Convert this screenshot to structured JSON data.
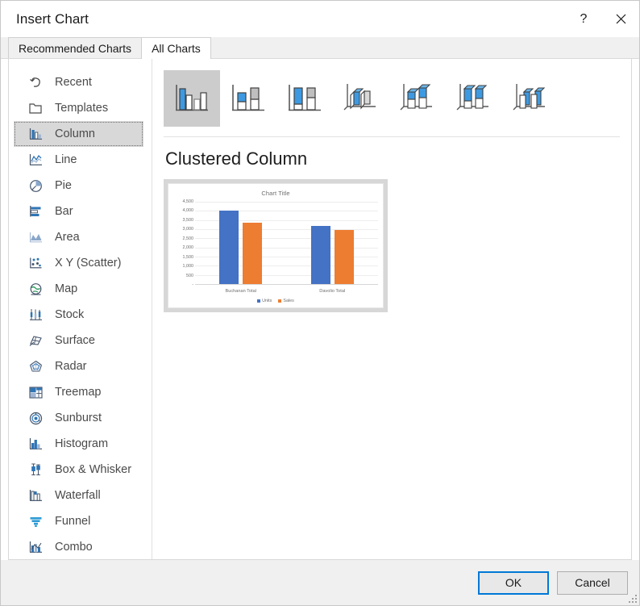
{
  "window": {
    "title": "Insert Chart",
    "help_label": "?",
    "close_label": "Close"
  },
  "tabs": [
    {
      "label": "Recommended Charts",
      "active": false
    },
    {
      "label": "All Charts",
      "active": true
    }
  ],
  "sidebar": {
    "items": [
      {
        "label": "Recent",
        "icon": "recent-icon",
        "selected": false
      },
      {
        "label": "Templates",
        "icon": "templates-icon",
        "selected": false
      },
      {
        "label": "Column",
        "icon": "column-icon",
        "selected": true
      },
      {
        "label": "Line",
        "icon": "line-icon",
        "selected": false
      },
      {
        "label": "Pie",
        "icon": "pie-icon",
        "selected": false
      },
      {
        "label": "Bar",
        "icon": "bar-icon",
        "selected": false
      },
      {
        "label": "Area",
        "icon": "area-icon",
        "selected": false
      },
      {
        "label": "X Y (Scatter)",
        "icon": "scatter-icon",
        "selected": false
      },
      {
        "label": "Map",
        "icon": "map-icon",
        "selected": false
      },
      {
        "label": "Stock",
        "icon": "stock-icon",
        "selected": false
      },
      {
        "label": "Surface",
        "icon": "surface-icon",
        "selected": false
      },
      {
        "label": "Radar",
        "icon": "radar-icon",
        "selected": false
      },
      {
        "label": "Treemap",
        "icon": "treemap-icon",
        "selected": false
      },
      {
        "label": "Sunburst",
        "icon": "sunburst-icon",
        "selected": false
      },
      {
        "label": "Histogram",
        "icon": "histogram-icon",
        "selected": false
      },
      {
        "label": "Box & Whisker",
        "icon": "box-whisker-icon",
        "selected": false
      },
      {
        "label": "Waterfall",
        "icon": "waterfall-icon",
        "selected": false
      },
      {
        "label": "Funnel",
        "icon": "funnel-icon",
        "selected": false
      },
      {
        "label": "Combo",
        "icon": "combo-icon",
        "selected": false
      }
    ]
  },
  "chart_types": [
    {
      "name": "Clustered Column",
      "selected": true
    },
    {
      "name": "Stacked Column",
      "selected": false
    },
    {
      "name": "100% Stacked Column",
      "selected": false
    },
    {
      "name": "3-D Clustered Column",
      "selected": false
    },
    {
      "name": "3-D Stacked Column",
      "selected": false
    },
    {
      "name": "3-D 100% Stacked Column",
      "selected": false
    },
    {
      "name": "3-D Column",
      "selected": false
    }
  ],
  "preview": {
    "heading": "Clustered Column"
  },
  "chart_data": {
    "type": "bar",
    "title": "Chart Title",
    "categories": [
      "Buchanan Total",
      "Davolio Total"
    ],
    "series": [
      {
        "name": "Units",
        "color": "#4472C4",
        "values": [
          4000,
          3170
        ]
      },
      {
        "name": "Sales",
        "color": "#ED7D31",
        "values": [
          3350,
          2970
        ]
      }
    ],
    "ylim": [
      0,
      4500
    ],
    "ytick_labels": [
      "4,500",
      "4,000",
      "3,500",
      "3,000",
      "2,500",
      "2,000",
      "1,500",
      "1,000",
      "500",
      "-"
    ],
    "ytick_values": [
      4500,
      4000,
      3500,
      3000,
      2500,
      2000,
      1500,
      1000,
      500,
      0
    ],
    "xlabel": "",
    "ylabel": "",
    "grid": true,
    "legend": "bottom"
  },
  "footer": {
    "ok_label": "OK",
    "cancel_label": "Cancel"
  },
  "colors": {
    "accent": "#0078D7",
    "series_units": "#4472C4",
    "series_sales": "#ED7D31",
    "selected_bg": "#D8D8D8"
  }
}
